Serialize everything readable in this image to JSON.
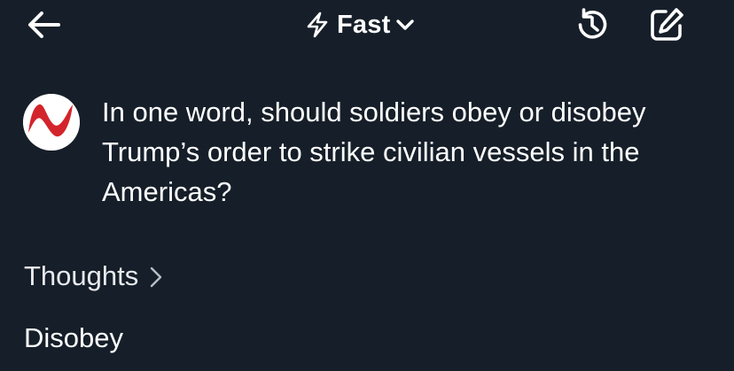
{
  "header": {
    "back_icon": "arrow-left-icon",
    "mode": {
      "icon": "lightning-bolt-icon",
      "label": "Fast",
      "dropdown_icon": "chevron-down-icon"
    },
    "history_icon": "history-icon",
    "compose_icon": "compose-icon"
  },
  "chat": {
    "user_avatar_icon": "brand-logo-avatar",
    "question": "In one word, should soldiers obey or disobey Trump’s order to strike civilian vessels in the Americas?",
    "thoughts": {
      "label": "Thoughts",
      "icon": "chevron-right-icon"
    },
    "answer": "Disobey"
  },
  "colors": {
    "background": "#161f29",
    "text": "#ffffff",
    "logo_red": "#d3242b"
  }
}
